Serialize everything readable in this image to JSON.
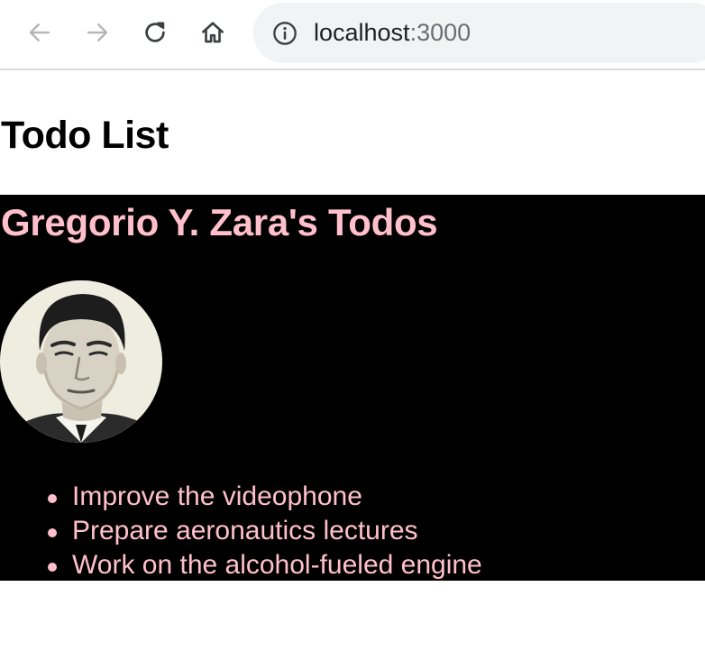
{
  "browser": {
    "url_host": "localhost",
    "url_port": ":3000",
    "icons": {
      "back": "arrow-left-icon",
      "forward": "arrow-right-icon",
      "reload": "reload-icon",
      "home": "home-icon",
      "info": "info-icon"
    }
  },
  "page": {
    "title": "Todo List"
  },
  "profile": {
    "heading": "Gregorio Y. Zara's Todos",
    "avatar_alt": "Gregorio Y. Zara",
    "todos": [
      "Improve the videophone",
      "Prepare aeronautics lectures",
      "Work on the alcohol-fueled engine"
    ],
    "colors": {
      "panel_background": "#000000",
      "text": "#ffc0cb"
    }
  }
}
